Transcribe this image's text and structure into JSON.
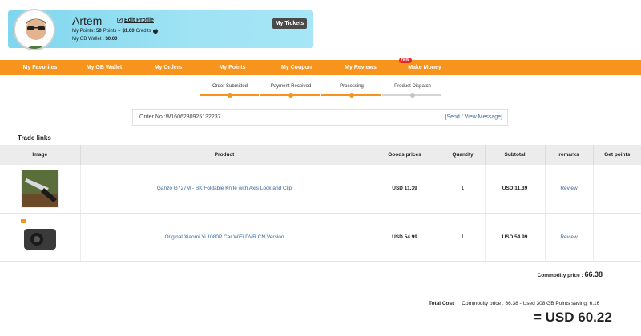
{
  "profile": {
    "name": "Artem",
    "edit_label": "Edit Profile",
    "points_prefix": "My Points:",
    "points": "50",
    "points_mid": "Points =",
    "points_value": "$1.00",
    "credits_label": "Credits",
    "wallet_label": "My GB Wallet :",
    "wallet_value": "$0.00",
    "tickets_label": "My Tickets"
  },
  "nav": {
    "items": [
      "My Favorites",
      "My GB Wallet",
      "My Orders",
      "My Points",
      "My Coupon",
      "My Reviews",
      "Make Money"
    ],
    "badge": "new"
  },
  "steps": [
    "Order Submitted",
    "Payment Received",
    "Processing",
    "Product Dispatch"
  ],
  "order": {
    "number_label": "Order No.:W1606230925132237",
    "message_link": "[Send / View Message]"
  },
  "trade_title": "Trade links",
  "table": {
    "headers": [
      "Image",
      "Product",
      "Goods prices",
      "Quantity",
      "Subtotal",
      "remarks",
      "Get points"
    ],
    "rows": [
      {
        "product": "Ganzo G727M - BK Foldable Knife with Axis Lock and Clip",
        "price": "USD 11.39",
        "qty": "1",
        "subtotal": "USD 11.39",
        "remark": "Review"
      },
      {
        "product": "Original Xiaomi Yi 1080P Car WiFi DVR CN Version",
        "price": "USD 54.99",
        "qty": "1",
        "subtotal": "USD 54.99",
        "remark": "Review"
      }
    ]
  },
  "summary": {
    "commodity_label": "Commodity price :",
    "commodity_value": "66.38",
    "total_label": "Total Cost",
    "total_detail": "Commodity price : 66.38 - Used 308 GB Points saving: 6.16",
    "grand_total": "= USD 60.22"
  },
  "colors": {
    "accent": "#f7941d",
    "link": "#336699",
    "profile_bg": "#9fe3f4"
  }
}
